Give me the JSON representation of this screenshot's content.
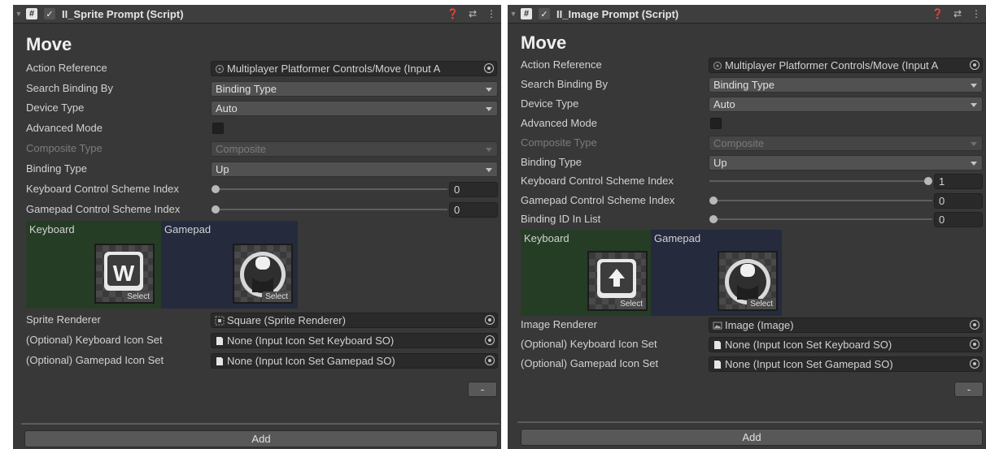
{
  "panels": [
    {
      "script_title": "II_Sprite Prompt (Script)",
      "big_title": "Move",
      "action_reference": {
        "label": "Action Reference",
        "value": "Multiplayer Platformer Controls/Move (Input A"
      },
      "search_binding_by": {
        "label": "Search Binding By",
        "value": "Binding Type"
      },
      "device_type": {
        "label": "Device Type",
        "value": "Auto"
      },
      "advanced_mode": {
        "label": "Advanced Mode",
        "checked": false
      },
      "composite_type": {
        "label": "Composite Type",
        "value": "Composite"
      },
      "binding_type": {
        "label": "Binding Type",
        "value": "Up"
      },
      "keyboard_index": {
        "label": "Keyboard Control Scheme Index",
        "value": "0",
        "fraction": 0
      },
      "gamepad_index": {
        "label": "Gamepad Control Scheme Index",
        "value": "0",
        "fraction": 0
      },
      "keyboard_label": "Keyboard",
      "gamepad_label": "Gamepad",
      "keyboard_glyph": "W",
      "select_label": "Select",
      "renderer": {
        "label": "Sprite Renderer",
        "value": "Square (Sprite Renderer)"
      },
      "kb_icon_set": {
        "label": "(Optional) Keyboard Icon Set",
        "value": "None (Input Icon Set Keyboard SO)"
      },
      "gp_icon_set": {
        "label": "(Optional) Gamepad Icon Set",
        "value": "None (Input Icon Set Gamepad SO)"
      },
      "minus_label": "-",
      "add_label": "Add"
    },
    {
      "script_title": "II_Image Prompt (Script)",
      "big_title": "Move",
      "action_reference": {
        "label": "Action Reference",
        "value": "Multiplayer Platformer Controls/Move (Input A"
      },
      "search_binding_by": {
        "label": "Search Binding By",
        "value": "Binding Type"
      },
      "device_type": {
        "label": "Device Type",
        "value": "Auto"
      },
      "advanced_mode": {
        "label": "Advanced Mode",
        "checked": false
      },
      "composite_type": {
        "label": "Composite Type",
        "value": "Composite"
      },
      "binding_type": {
        "label": "Binding Type",
        "value": "Up"
      },
      "keyboard_index": {
        "label": "Keyboard Control Scheme Index",
        "value": "1",
        "fraction": 1
      },
      "gamepad_index": {
        "label": "Gamepad Control Scheme Index",
        "value": "0",
        "fraction": 0
      },
      "binding_id": {
        "label": "Binding ID In List",
        "value": "0",
        "fraction": 0
      },
      "keyboard_label": "Keyboard",
      "gamepad_label": "Gamepad",
      "select_label": "Select",
      "renderer": {
        "label": "Image Renderer",
        "value": "Image (Image)"
      },
      "kb_icon_set": {
        "label": "(Optional) Keyboard Icon Set",
        "value": "None (Input Icon Set Keyboard SO)"
      },
      "gp_icon_set": {
        "label": "(Optional) Gamepad Icon Set",
        "value": "None (Input Icon Set Gamepad SO)"
      },
      "minus_label": "-",
      "add_label": "Add"
    }
  ],
  "colors": {
    "panel_bg": "#383838",
    "field_bg": "#2a2a2a",
    "keyboard_bg": "#253d25",
    "gamepad_bg": "#252b3d"
  }
}
